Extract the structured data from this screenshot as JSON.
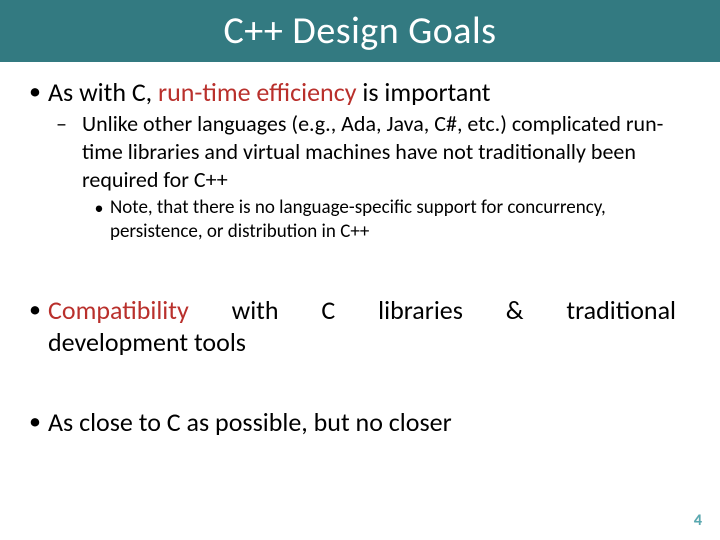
{
  "title": "C++ Design Goals",
  "bullets": {
    "b1_pre": "As with C, ",
    "b1_emph": "run-time efficiency",
    "b1_post": " is important",
    "b1_sub": "Unlike other languages (e.g., Ada, Java, C#, etc.) complicated run-time libraries and virtual machines have not traditionally been required for C++",
    "b1_note": "Note, that there is no language-specific support for concurrency, persistence, or distribution in C++",
    "b2_emph": "Compatibility",
    "b2_line1_rest": " with C libraries & traditional",
    "b2_line2": "development tools",
    "b3": "As close to C as possible, but no closer"
  },
  "glyphs": {
    "dot": "•",
    "dash": "–"
  },
  "page_number": "4"
}
